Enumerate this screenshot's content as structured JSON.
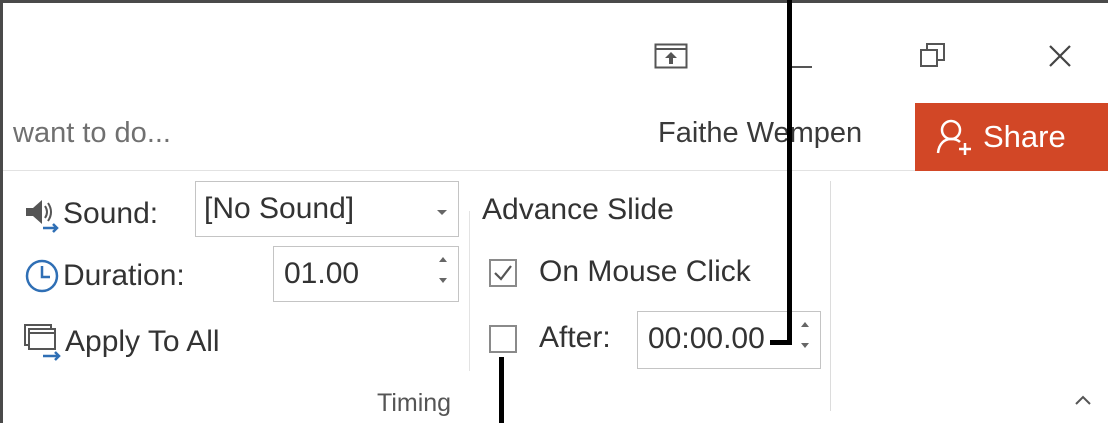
{
  "window": {
    "controls": [
      "ribbon-display-options",
      "minimize",
      "restore",
      "close"
    ]
  },
  "tellme": {
    "text": "want to do..."
  },
  "account": {
    "user_name": "Faithe Wempen",
    "share_label": "Share"
  },
  "timing_group": {
    "sound_label": "Sound:",
    "sound_value": "[No Sound]",
    "duration_label": "Duration:",
    "duration_value": "01.00",
    "apply_label": "Apply To All",
    "advance_title": "Advance Slide",
    "on_mouse_click_label": "On Mouse Click",
    "on_mouse_click_checked": true,
    "after_label": "After:",
    "after_checked": false,
    "after_value": "00:00.00",
    "group_label": "Timing"
  },
  "colors": {
    "share_bg": "#d24726",
    "accent_blue": "#2f6fb5"
  },
  "icons": {
    "sound": "speaker-icon",
    "duration": "clock-icon",
    "apply": "apply-to-all-icon"
  }
}
